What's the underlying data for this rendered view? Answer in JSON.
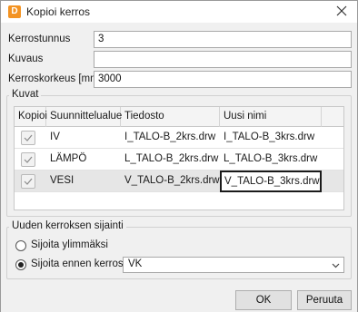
{
  "window": {
    "title": "Kopioi kerros",
    "app_icon_letter": "D",
    "app_icon_color": "#f39322"
  },
  "form": {
    "kerrostunnus_label": "Kerrostunnus",
    "kerrostunnus_value": "3",
    "kuvaus_label": "Kuvaus",
    "kuvaus_value": "",
    "kerroskorkeus_label": "Kerroskorkeus [mm]",
    "kerroskorkeus_value": "3000"
  },
  "kuvat": {
    "group_title": "Kuvat",
    "columns": [
      "Kopioi",
      "Suunnittelualue",
      "Tiedosto",
      "Uusi nimi"
    ],
    "rows": [
      {
        "checked": true,
        "suunnittelualue": "IV",
        "tiedosto": "I_TALO-B_2krs.drw",
        "uusi_nimi": "I_TALO-B_3krs.drw"
      },
      {
        "checked": true,
        "suunnittelualue": "LÄMPÖ",
        "tiedosto": "L_TALO-B_2krs.drw",
        "uusi_nimi": "L_TALO-B_3krs.drw"
      },
      {
        "checked": true,
        "suunnittelualue": "VESI",
        "tiedosto": "V_TALO-B_2krs.drw",
        "uusi_nimi": "V_TALO-B_3krs.drw",
        "selected": true
      }
    ]
  },
  "sijainti": {
    "group_title": "Uuden kerroksen sijainti",
    "option_top": "Sijoita ylimmäksi",
    "option_before": "Sijoita ennen kerrosta:",
    "selected_option": "option_before",
    "combo_value": "VK"
  },
  "footer": {
    "ok_label": "OK",
    "cancel_label": "Peruuta"
  }
}
